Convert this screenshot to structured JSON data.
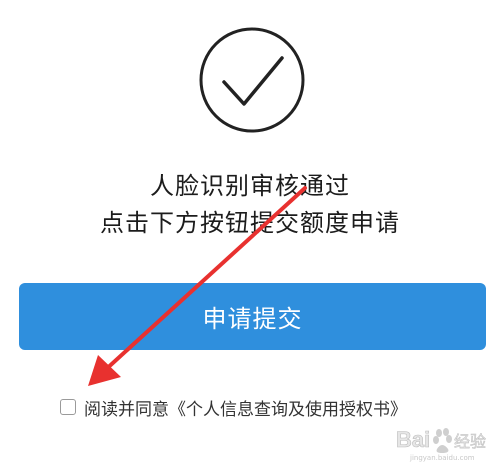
{
  "result": {
    "icon": "checkmark-circle-icon",
    "title": "人脸识别审核通过",
    "subtitle": "点击下方按钮提交额度申请"
  },
  "actions": {
    "submit_label": "申请提交",
    "button_color": "#2f8fdd"
  },
  "agreement": {
    "prefix": "阅读并同意",
    "link_text": "《个人信息查询及使用授权书》",
    "checked": false
  },
  "annotation": {
    "arrow_color": "#e8312f"
  },
  "watermark": {
    "brand": "Bai",
    "suffix": "经验",
    "url": "jingyan.baidu.com"
  }
}
